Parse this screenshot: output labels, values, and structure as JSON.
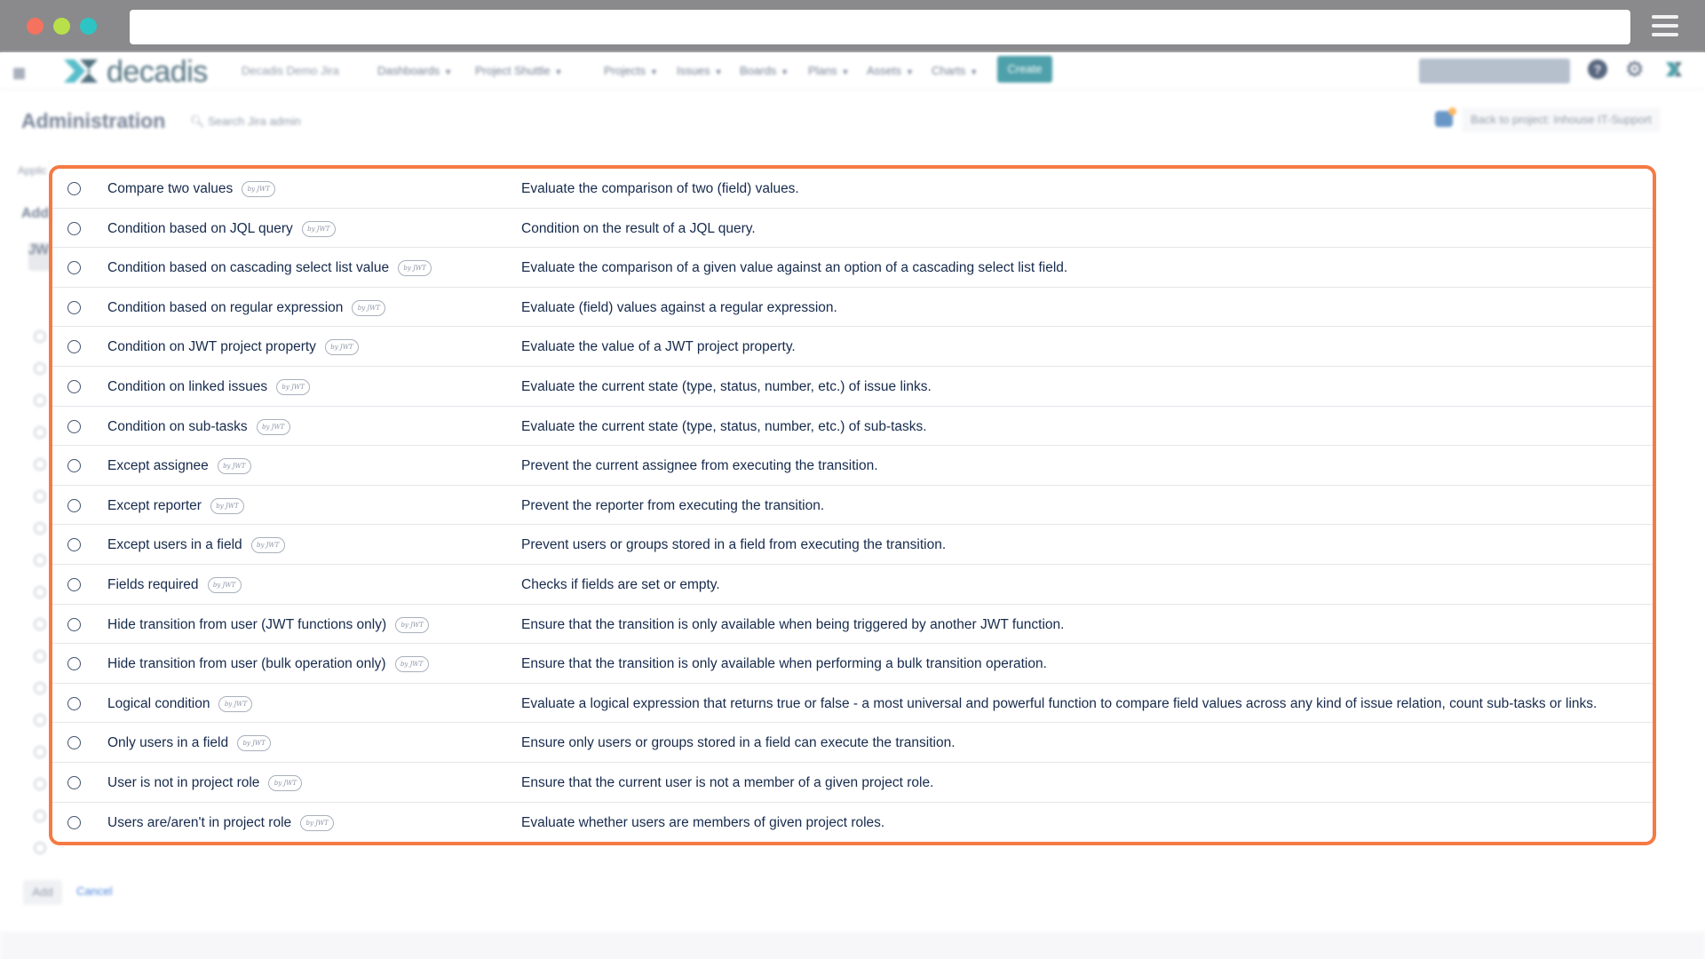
{
  "browser": {
    "url": ""
  },
  "jira": {
    "logo_text": "decadis",
    "site_name": "Decadis Demo Jira",
    "nav": [
      "Dashboards",
      "Project Shuttle",
      "Projects",
      "Issues",
      "Boards",
      "Plans",
      "Assets",
      "Charts"
    ],
    "create_label": "Create",
    "help_glyph": "?",
    "admin_title": "Administration",
    "admin_search": "Search Jira admin",
    "back_link": "Back to project: Inhouse IT-Support",
    "tabs_partial": "Applic",
    "side_heading": "Add",
    "side_chip": "JW",
    "add_label": "Add",
    "cancel_label": "Cancel"
  },
  "badge_text": "by JWT",
  "conditions": [
    {
      "name": "Compare two values",
      "description": "Evaluate the comparison of two (field) values."
    },
    {
      "name": "Condition based on JQL query",
      "description": "Condition on the result of a JQL query."
    },
    {
      "name": "Condition based on cascading select list value",
      "description": "Evaluate the comparison of a given value against an option of a cascading select list field."
    },
    {
      "name": "Condition based on regular expression",
      "description": "Evaluate (field) values against a regular expression."
    },
    {
      "name": "Condition on JWT project property",
      "description": "Evaluate the value of a JWT project property."
    },
    {
      "name": "Condition on linked issues",
      "description": "Evaluate the current state (type, status, number, etc.) of issue links."
    },
    {
      "name": "Condition on sub-tasks",
      "description": "Evaluate the current state (type, status, number, etc.) of sub-tasks."
    },
    {
      "name": "Except assignee",
      "description": "Prevent the current assignee from executing the transition."
    },
    {
      "name": "Except reporter",
      "description": "Prevent the reporter from executing the transition."
    },
    {
      "name": "Except users in a field",
      "description": "Prevent users or groups stored in a field from executing the transition."
    },
    {
      "name": "Fields required",
      "description": "Checks if fields are set or empty."
    },
    {
      "name": "Hide transition from user (JWT functions only)",
      "description": "Ensure that the transition is only available when being triggered by another JWT function."
    },
    {
      "name": "Hide transition from user (bulk operation only)",
      "description": "Ensure that the transition is only available when performing a bulk transition operation."
    },
    {
      "name": "Logical condition",
      "description": "Evaluate a logical expression that returns true or false - a most universal and powerful function to compare field values across any kind of issue relation, count sub-tasks or links."
    },
    {
      "name": "Only users in a field",
      "description": "Ensure only users or groups stored in a field can execute the transition."
    },
    {
      "name": "User is not in project role",
      "description": "Ensure that the current user is not a member of a given project role."
    },
    {
      "name": "Users are/aren't in project role",
      "description": "Evaluate whether users are members of given project roles."
    }
  ],
  "colors": {
    "highlight": "#f57a43",
    "brand": "#0b7c8a"
  }
}
